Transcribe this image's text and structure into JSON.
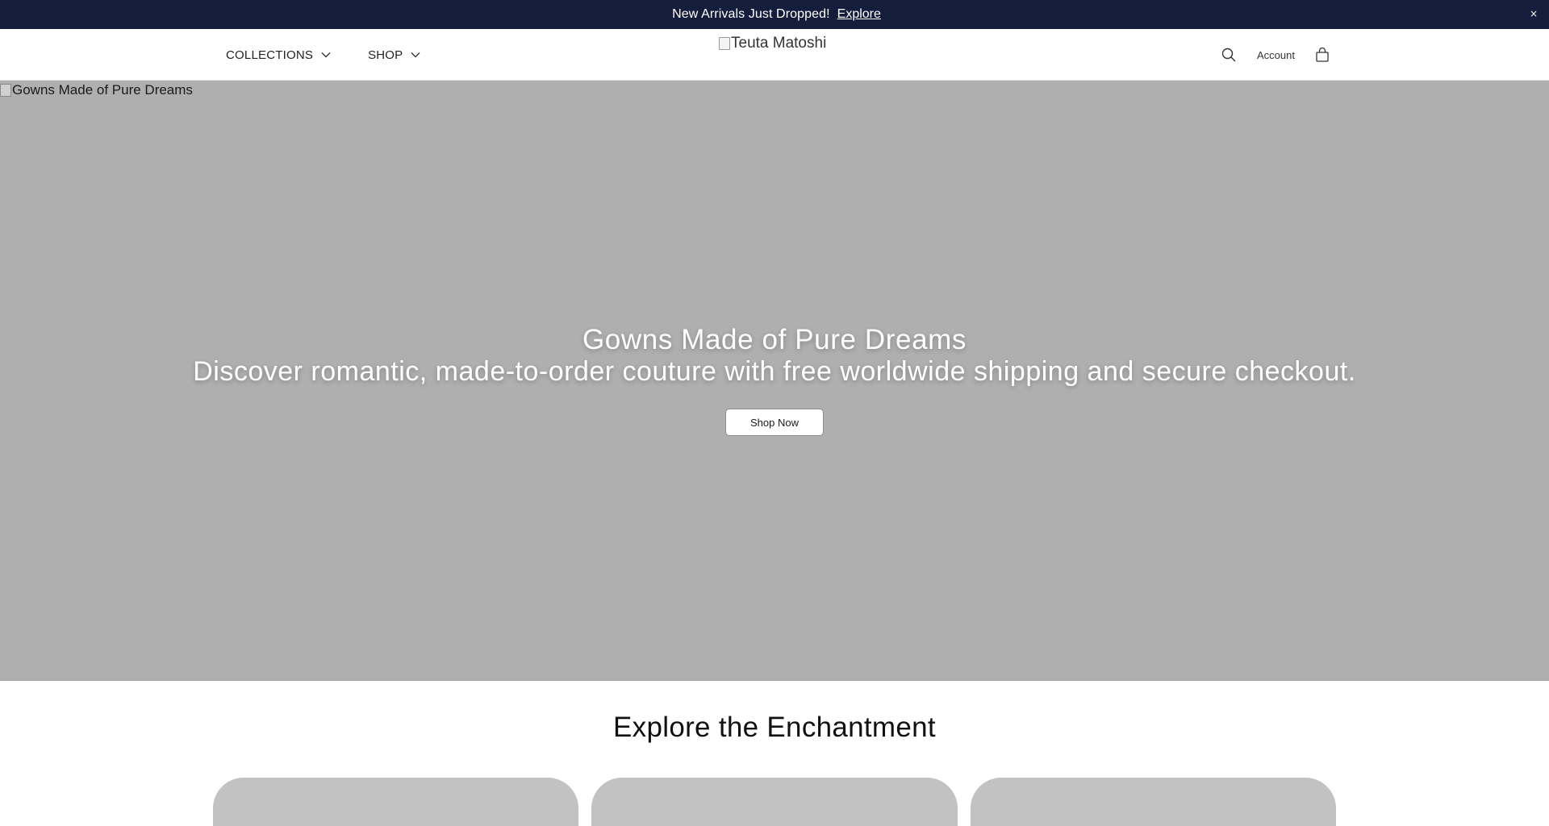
{
  "announcement": {
    "glyph": "",
    "message": "New Arrivals Just Dropped!",
    "link_label": "Explore",
    "close_glyph": "×"
  },
  "header": {
    "nav": [
      {
        "label": "COLLECTIONS"
      },
      {
        "label": "SHOP"
      }
    ],
    "logo_alt": "Teuta Matoshi",
    "account_label": "Account",
    "icons": [
      "search-icon",
      "bag-icon",
      "chevron-down-icon"
    ]
  },
  "hero": {
    "image_alt": "Gowns Made of Pure Dreams",
    "title": "Gowns Made of Pure Dreams",
    "subtitle": "Discover romantic, made-to-order couture with free worldwide shipping and secure checkout.",
    "cta_label": "Shop Now",
    "background_color": "#afafaf"
  },
  "explore": {
    "title": "Explore the Enchantment",
    "cards": 3
  },
  "colors": {
    "announcement_bg": "#141e3c",
    "card_placeholder": "#c2c2c2"
  }
}
